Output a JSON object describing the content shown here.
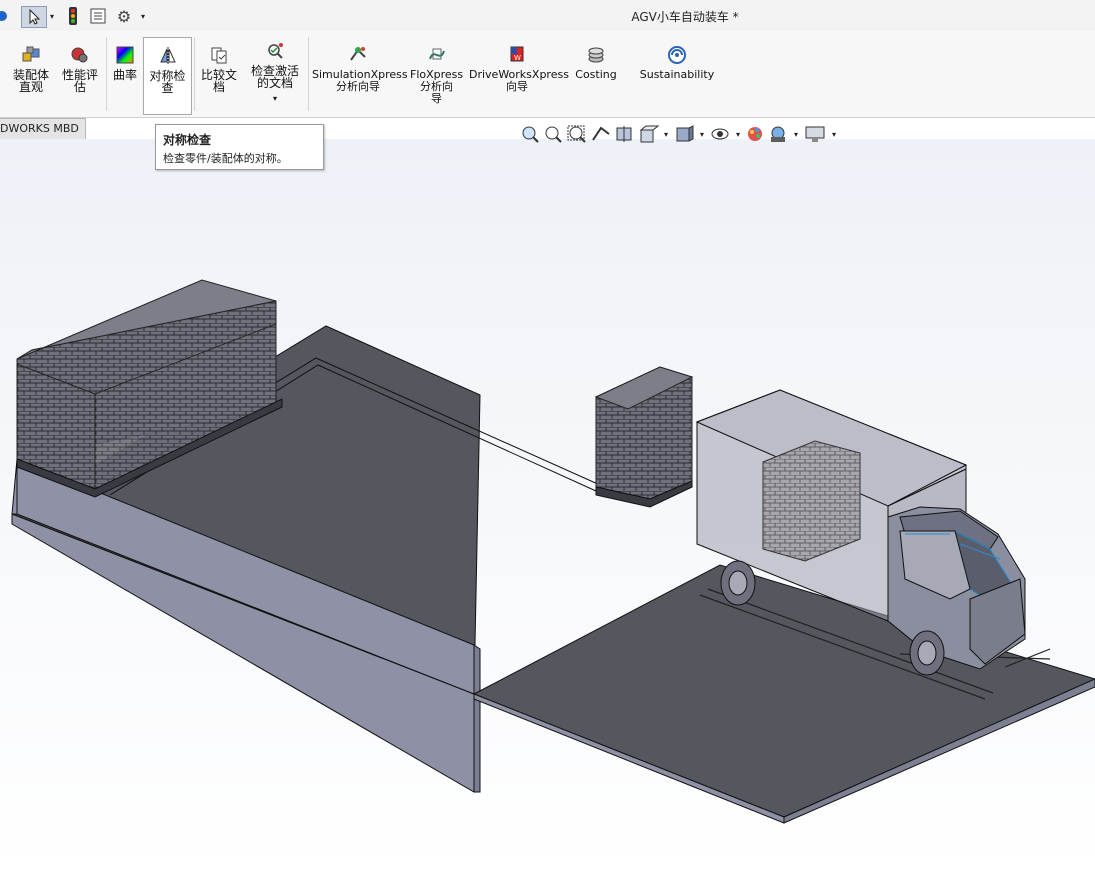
{
  "window": {
    "title": "AGV小车自动装车 *"
  },
  "colors": {
    "accent": "#1e64c8",
    "viewport_top": "#eef1f7",
    "floor_dark": "#555763",
    "floor_side": "#8b8ea3",
    "box": "#686a76"
  },
  "ribbon": {
    "buttons": [
      {
        "label": "装配体\n直观",
        "icon": "assembly-visualization-icon"
      },
      {
        "label": "性能评\n估",
        "icon": "performance-evaluation-icon"
      },
      {
        "label": "曲率",
        "icon": "curvature-icon"
      },
      {
        "label": "对称检\n查",
        "icon": "symmetry-check-icon"
      },
      {
        "label": "比较文\n档",
        "icon": "compare-documents-icon"
      },
      {
        "label": "检查激活\n的文档",
        "icon": "check-active-document-icon"
      },
      {
        "label": "SimulationXpress\n分析向导",
        "icon": "simulationxpress-icon"
      },
      {
        "label": "FloXpress\n分析向\n导",
        "icon": "floxpress-icon"
      },
      {
        "label": "DriveWorksXpress\n向导",
        "icon": "driveworksxpress-icon"
      },
      {
        "label": "Costing",
        "icon": "costing-icon"
      },
      {
        "label": "Sustainability",
        "icon": "sustainability-icon"
      }
    ]
  },
  "tabs": {
    "mbd": "DWORKS MBD"
  },
  "tooltip": {
    "title": "对称检查",
    "description": "检查零件/装配体的对称。"
  }
}
